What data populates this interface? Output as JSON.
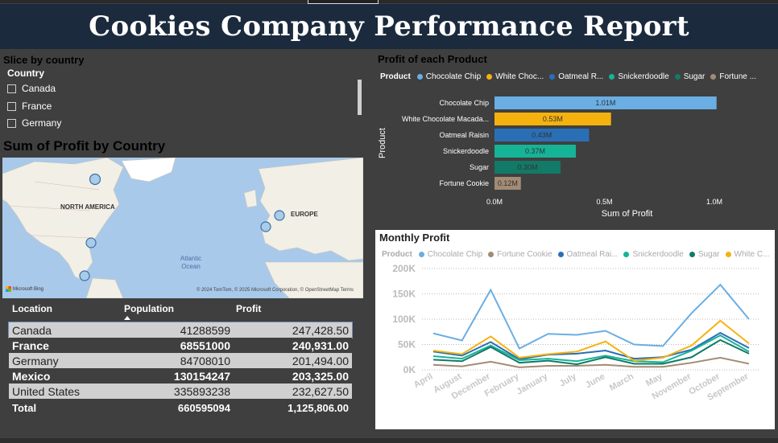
{
  "report": {
    "title": "Cookies Company Performance Report"
  },
  "slicer": {
    "title": "Slice by country",
    "header": "Country",
    "items": [
      "Canada",
      "France",
      "Germany"
    ]
  },
  "map": {
    "title": "Sum of Profit by Country",
    "labels": {
      "north_america": "NORTH AMERICA",
      "europe": "EUROPE",
      "ocean": "Atlantic Ocean"
    },
    "bing": "Microsoft Bing",
    "credit": "© 2024 TomTom, © 2025 Microsoft Corporation, © OpenStreetMap  Terms"
  },
  "table": {
    "headers": {
      "location": "Location",
      "population": "Population",
      "profit": "Profit"
    },
    "rows": [
      {
        "location": "Canada",
        "population": "41288599",
        "profit": "247,428.50"
      },
      {
        "location": "France",
        "population": "68551000",
        "profit": "240,931.00"
      },
      {
        "location": "Germany",
        "population": "84708010",
        "profit": "201,494.00"
      },
      {
        "location": "Mexico",
        "population": "130154247",
        "profit": "203,325.00"
      },
      {
        "location": "United States",
        "population": "335893238",
        "profit": "232,627.50"
      }
    ],
    "total": {
      "label": "Total",
      "population": "660595094",
      "profit": "1,125,806.00"
    }
  },
  "colors": {
    "Chocolate Chip": "#6aaee3",
    "White Chocolate Macadamia Nut": "#f5b20f",
    "Oatmeal Raisin": "#2a6fb5",
    "Snickerdoodle": "#15b497",
    "Sugar": "#127a67",
    "Fortune Cookie": "#a38b74"
  },
  "bar_chart": {
    "title": "Profit of each Product",
    "legend_title": "Product",
    "legend_items": [
      "Chocolate Chip",
      "White Choc...",
      "Oatmeal R...",
      "Snickerdoodle",
      "Sugar",
      "Fortune ..."
    ],
    "xlabel": "Sum of Profit",
    "ylabel": "Product",
    "ticks": [
      "0.0M",
      "0.5M",
      "1.0M"
    ]
  },
  "line_chart": {
    "title": "Monthly Profit",
    "legend_title": "Product",
    "legend_items": [
      "Chocolate Chip",
      "Fortune Cookie",
      "Oatmeal Rai...",
      "Snickerdoodle",
      "Sugar",
      "White C..."
    ],
    "yticks": [
      "200K",
      "150K",
      "100K",
      "50K",
      "0K"
    ]
  },
  "chart_data": [
    {
      "type": "bar",
      "title": "Profit of each Product",
      "xlabel": "Sum of Profit",
      "ylabel": "Product",
      "xlim": [
        0,
        1100000
      ],
      "categories": [
        "Chocolate Chip",
        "White Chocolate Macada...",
        "Oatmeal Raisin",
        "Snickerdoodle",
        "Sugar",
        "Fortune Cookie"
      ],
      "values": [
        1010000,
        530000,
        430000,
        370000,
        300000,
        120000
      ],
      "data_labels": [
        "1.01M",
        "0.53M",
        "0.43M",
        "0.37M",
        "0.30M",
        "0.12M"
      ],
      "grid": false
    },
    {
      "type": "line",
      "title": "Monthly Profit",
      "x": [
        "April",
        "August",
        "December",
        "February",
        "January",
        "July",
        "June",
        "March",
        "May",
        "November",
        "October",
        "September"
      ],
      "ylim": [
        0,
        200000
      ],
      "grid": true,
      "series": [
        {
          "name": "Chocolate Chip",
          "values": [
            72000,
            58000,
            158000,
            42000,
            71000,
            69000,
            77000,
            50000,
            47000,
            112000,
            168000,
            100000
          ]
        },
        {
          "name": "Fortune Cookie",
          "values": [
            10000,
            7000,
            16000,
            5000,
            8000,
            8000,
            10000,
            6000,
            6000,
            14000,
            24000,
            12000
          ]
        },
        {
          "name": "Oatmeal Raisin",
          "values": [
            36000,
            28000,
            55000,
            21000,
            30000,
            32000,
            38000,
            22000,
            25000,
            40000,
            73000,
            43000
          ]
        },
        {
          "name": "Snickerdoodle",
          "values": [
            27000,
            22000,
            48000,
            19000,
            22000,
            17000,
            28000,
            17000,
            15000,
            38000,
            68000,
            36000
          ]
        },
        {
          "name": "Sugar",
          "values": [
            20000,
            17000,
            45000,
            14000,
            18000,
            11000,
            25000,
            12000,
            12000,
            25000,
            59000,
            32000
          ]
        },
        {
          "name": "White Chocolate Macadamia Nut",
          "values": [
            38000,
            31000,
            66000,
            24000,
            31000,
            36000,
            56000,
            18000,
            24000,
            48000,
            97000,
            52000
          ]
        }
      ]
    }
  ]
}
